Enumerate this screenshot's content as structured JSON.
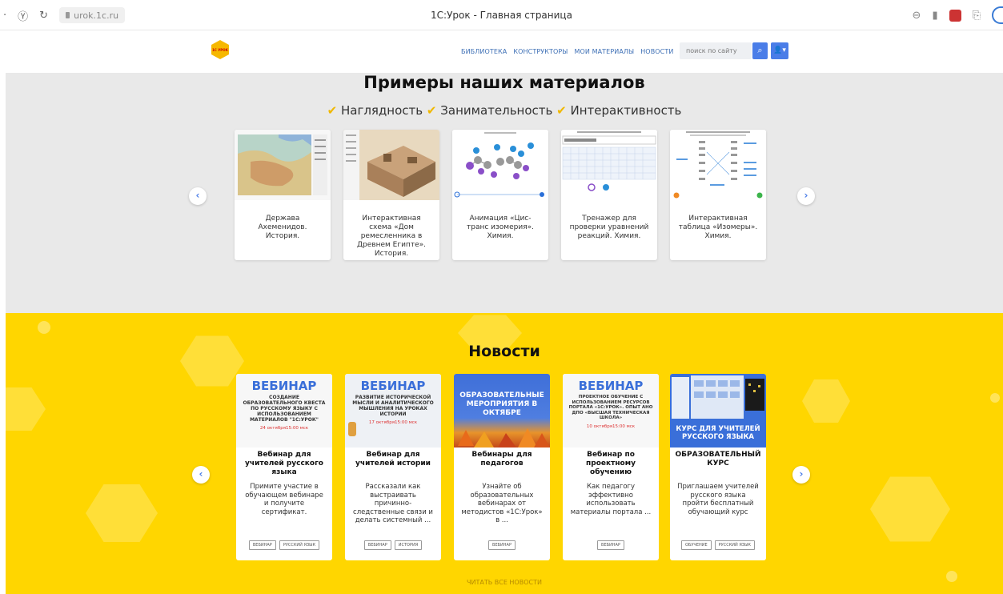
{
  "browser": {
    "url": "urok.1c.ru",
    "title": "1С:Урок - Главная страница"
  },
  "nav": {
    "logo": "1С УРОК",
    "links": [
      "БИБЛИОТЕКА",
      "КОНСТРУКТОРЫ",
      "МОИ МАТЕРИАЛЫ",
      "НОВОСТИ"
    ],
    "search_placeholder": "поиск по сайту"
  },
  "examples": {
    "title": "Примеры наших материалов",
    "features": [
      "Наглядность",
      "Занимательность",
      "Интерактивность"
    ],
    "cards": [
      {
        "caption": "Держава Ахеменидов. История."
      },
      {
        "caption": "Интерактивная схема «Дом ремесленника в Древнем Египте». История."
      },
      {
        "caption": "Анимация «Цис-транс изомерия». Химия."
      },
      {
        "caption": "Тренажер для проверки уравнений реакций. Химия."
      },
      {
        "caption": "Интерактивная таблица «Изомеры». Химия."
      }
    ]
  },
  "news": {
    "title": "Новости",
    "read_all": "ЧИТАТЬ ВСЕ НОВОСТИ",
    "cards": [
      {
        "img_title": "ВЕБИНАР",
        "img_sub": "СОЗДАНИЕ ОБРАЗОВАТЕЛЬНОГО КВЕСТА ПО РУССКОМУ ЯЗЫКУ С ИСПОЛЬЗОВАНИЕМ МАТЕРИАЛОВ \"1С:УРОК\"",
        "img_date": "24 октября15:00 мск",
        "heading": "Вебинар для учителей русского языка",
        "text": "Примите участие в обучающем вебинаре и получите сертификат.",
        "tags": [
          "ВЕБИНАР",
          "РУССКИЙ ЯЗЫК"
        ]
      },
      {
        "img_title": "ВЕБИНАР",
        "img_sub": "РАЗВИТИЕ ИСТОРИЧЕСКОЙ МЫСЛИ И АНАЛИТИЧЕСКОГО МЫШЛЕНИЯ НА УРОКАХ ИСТОРИИ",
        "img_date": "17 октября15:00 мск",
        "heading": "Вебинар для учителей истории",
        "text": "Рассказали как выстраивать причинно-следственные связи и делать системный ...",
        "tags": [
          "ВЕБИНАР",
          "ИСТОРИЯ"
        ]
      },
      {
        "img_title": "ОБРАЗОВАТЕЛЬНЫЕ МЕРОПРИЯТИЯ В ОКТЯБРЕ",
        "heading": "Вебинары для педагогов",
        "text": "Узнайте об образовательных вебинарах от методистов «1С:Урок» в ...",
        "tags": [
          "ВЕБИНАР"
        ]
      },
      {
        "img_title": "ВЕБИНАР",
        "img_sub": "ПРОЕКТНОЕ ОБУЧЕНИЕ С ИСПОЛЬЗОВАНИЕМ РЕСУРСОВ ПОРТАЛА «1С:УРОК». ОПЫТ АНО ДПО «ВЫСШАЯ ТЕХНИЧЕСКАЯ ШКОЛА»",
        "img_date": "10 октября15:00 мск",
        "heading": "Вебинар по проектному обучению",
        "text": "Как педагогу эффективно использовать материалы портала ...",
        "tags": [
          "ВЕБИНАР"
        ]
      },
      {
        "img_title": "КУРС ДЛЯ УЧИТЕЛЕЙ РУССКОГО ЯЗЫКА",
        "heading": "ОБРАЗОВАТЕЛЬНЫЙ КУРС",
        "text": "Приглашаем учителей русского языка пройти бесплатный обучающий курс",
        "tags": [
          "ОБУЧЕНИЕ",
          "РУССКИЙ ЯЗЫК"
        ]
      }
    ]
  },
  "colors": {
    "accent_blue": "#4a7de8",
    "news_yellow": "#ffd600",
    "check_yellow": "#f0b800"
  }
}
